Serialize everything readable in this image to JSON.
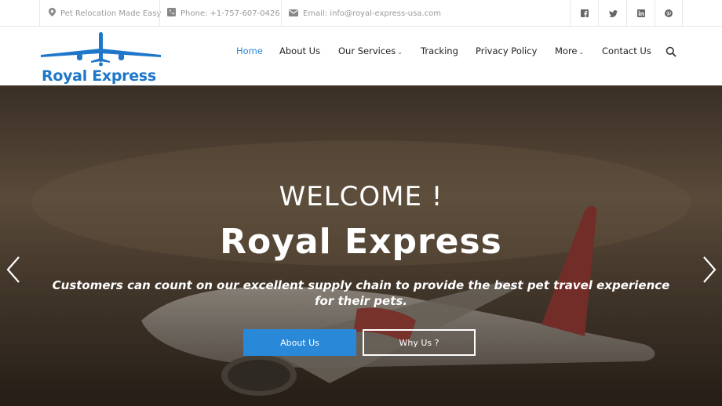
{
  "topbar": {
    "tagline": "Pet Relocation Made Easy",
    "phone": "Phone: +1-757-607-0426",
    "email": "Email: info@royal-express-usa.com",
    "social": [
      "facebook-icon",
      "twitter-icon",
      "linkedin-icon",
      "pinterest-icon"
    ]
  },
  "logo": {
    "brand": "Royal Express"
  },
  "nav": {
    "items": [
      {
        "label": "Home",
        "active": true
      },
      {
        "label": "About Us"
      },
      {
        "label": "Our Services",
        "dropdown": true
      },
      {
        "label": "Tracking"
      },
      {
        "label": "Privacy Policy"
      },
      {
        "label": "More",
        "dropdown": true
      },
      {
        "label": "Contact Us"
      }
    ],
    "dropdown_glyph": "⌄"
  },
  "hero": {
    "welcome": "WELCOME !",
    "title": "Royal Express",
    "tagline": "Customers can count on our excellent supply chain to provide the best pet travel experience for their pets.",
    "primary_button": "About Us",
    "secondary_button": "Why Us ?"
  },
  "colors": {
    "accent": "#2a88d8",
    "logo_blue": "#1e77c9"
  }
}
